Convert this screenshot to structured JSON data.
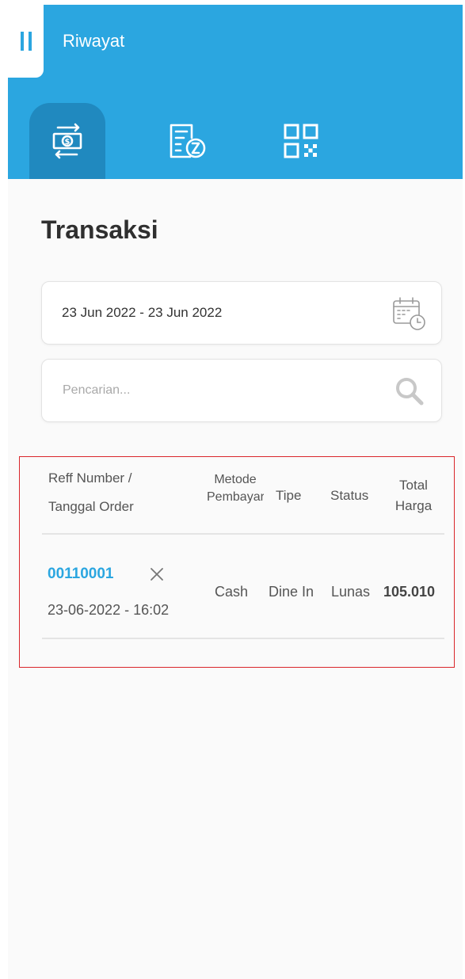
{
  "header": {
    "title": "Riwayat",
    "tabs": [
      {
        "name": "transactions",
        "icon": "money-exchange-icon",
        "active": true
      },
      {
        "name": "pending",
        "icon": "pending-bill-icon",
        "active": false
      },
      {
        "name": "qr",
        "icon": "qr-code-icon",
        "active": false
      }
    ],
    "colors": {
      "primary": "#2ba6e0",
      "active_tab": "#2089bf"
    }
  },
  "main": {
    "title": "Transaksi",
    "date_range": "23 Jun 2022 - 23 Jun 2022",
    "search": {
      "placeholder": "Pencarian...",
      "value": ""
    }
  },
  "table": {
    "headers": {
      "reff_line1": "Reff Number /",
      "reff_line2": "Tanggal Order",
      "metode": "Metode Pembayaran",
      "tipe": "Tipe",
      "status": "Status",
      "total_line1": "Total",
      "total_line2": "Harga"
    },
    "rows": [
      {
        "reff": "00110001",
        "date": "23-06-2022 - 16:02",
        "metode": "Cash",
        "tipe": "Dine In",
        "status": "Lunas",
        "total": "105.010"
      }
    ],
    "accent": "#2ba6e0",
    "highlight_border": "#d9262b"
  }
}
